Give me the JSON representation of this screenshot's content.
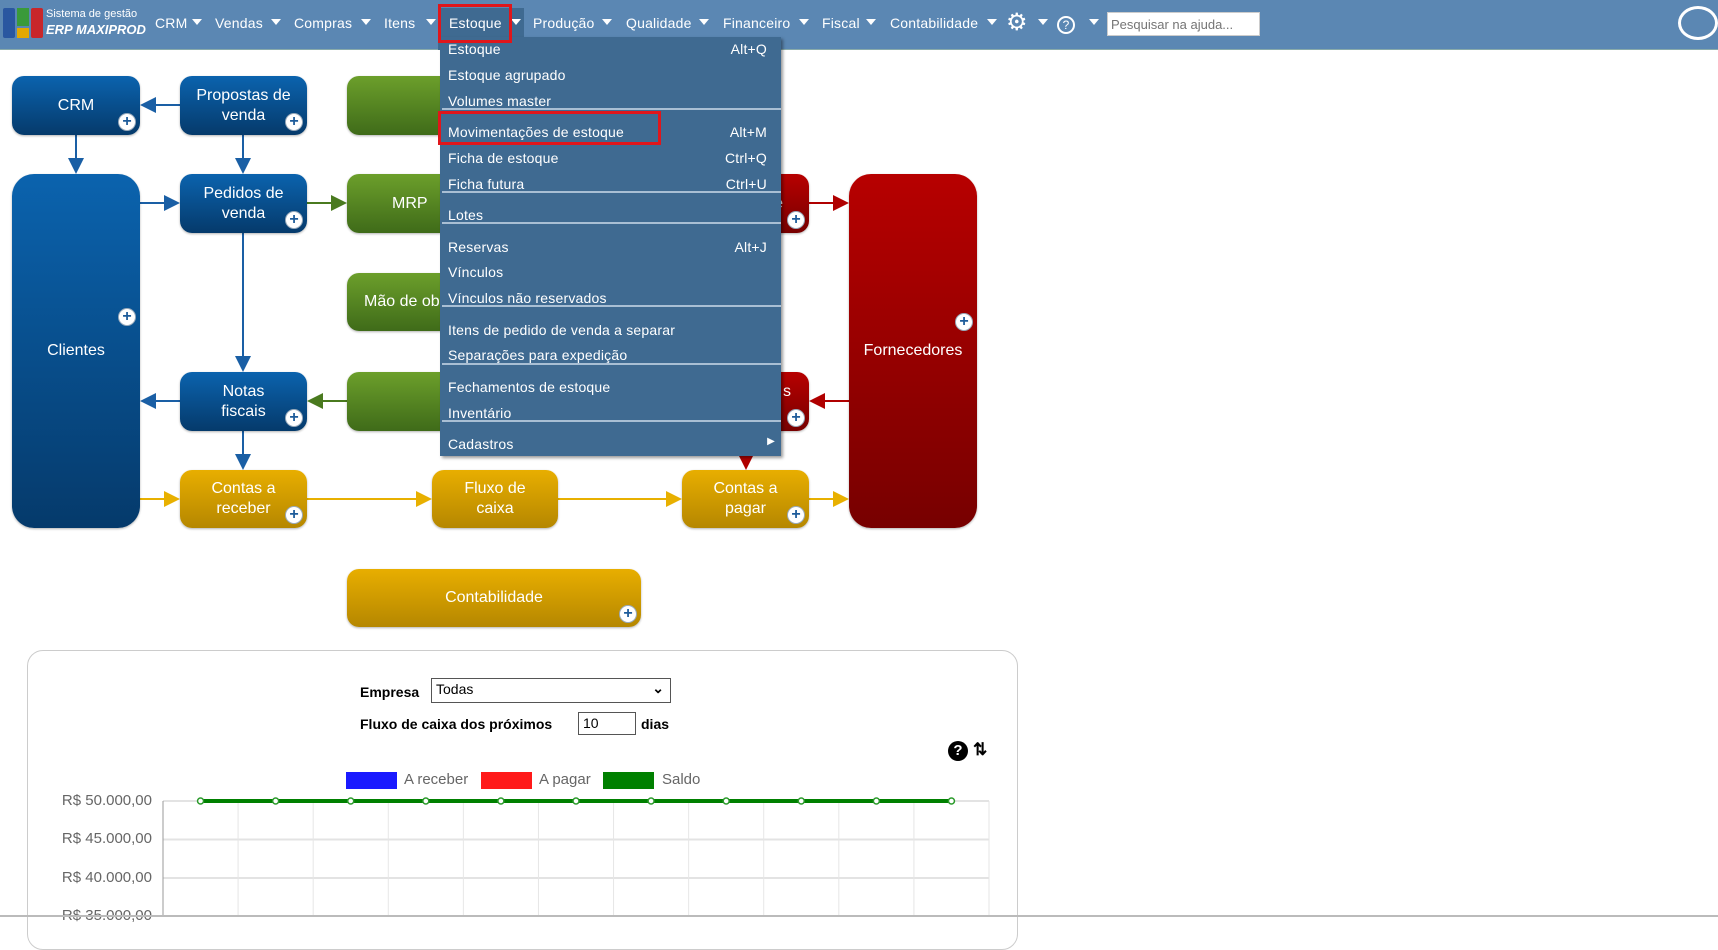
{
  "header": {
    "logo_line1": "Sistema de gestão",
    "logo_line2": "ERP MAXIPROD",
    "nav": [
      "CRM",
      "Vendas",
      "Compras",
      "Itens",
      "Estoque",
      "Produção",
      "Qualidade",
      "Financeiro",
      "Fiscal",
      "Contabilidade"
    ],
    "search_placeholder": "Pesquisar na ajuda..."
  },
  "menu": {
    "items": [
      {
        "label": "Estoque",
        "shortcut": "Alt+Q"
      },
      {
        "label": "Estoque agrupado",
        "shortcut": ""
      },
      {
        "label": "Volumes master",
        "shortcut": ""
      },
      {
        "label": "Movimentações de estoque",
        "shortcut": "Alt+M"
      },
      {
        "label": "Ficha de estoque",
        "shortcut": "Ctrl+Q"
      },
      {
        "label": "Ficha futura",
        "shortcut": "Ctrl+U"
      },
      {
        "label": "Lotes",
        "shortcut": ""
      },
      {
        "label": "Reservas",
        "shortcut": "Alt+J"
      },
      {
        "label": "Vínculos",
        "shortcut": ""
      },
      {
        "label": "Vínculos não reservados",
        "shortcut": ""
      },
      {
        "label": "Itens de pedido de venda a separar",
        "shortcut": ""
      },
      {
        "label": "Separações para expedição",
        "shortcut": ""
      },
      {
        "label": "Fechamentos de estoque",
        "shortcut": ""
      },
      {
        "label": "Inventário",
        "shortcut": ""
      },
      {
        "label": "Cadastros",
        "shortcut": ""
      }
    ]
  },
  "diagram": {
    "crm": "CRM",
    "propostas": "Propostas de\nvenda",
    "clientes": "Clientes",
    "pedidos": "Pedidos de\nvenda",
    "mrp": "MRP",
    "mao": "Mão de ob",
    "notas": "Notas\nfiscais",
    "fornecedores": "Fornecedores",
    "receber": "Contas a\nreceber",
    "fluxo": "Fluxo de\ncaixa",
    "pagar": "Contas a\npagar",
    "contabilidade": "Contabilidade",
    "red1": "e",
    "red2": "s"
  },
  "cashflow": {
    "empresa_label": "Empresa",
    "empresa_value": "Todas",
    "fluxo_label": "Fluxo de caixa dos próximos",
    "dias_value": "10",
    "dias_label": "dias"
  },
  "chart_data": {
    "type": "line",
    "title": "",
    "ylim": [
      35000,
      50000
    ],
    "yticks": [
      "R$ 50.000,00",
      "R$ 45.000,00",
      "R$ 40.000,00",
      "R$ 35.000,00"
    ],
    "legend": [
      "A receber",
      "A pagar",
      "Saldo"
    ],
    "legend_colors": [
      "#1a1aff",
      "#ff1a1a",
      "#008000"
    ],
    "series": [
      {
        "name": "A receber",
        "values": []
      },
      {
        "name": "A pagar",
        "values": []
      },
      {
        "name": "Saldo",
        "values": [
          50000,
          50000,
          50000,
          50000,
          50000,
          50000,
          50000,
          50000,
          50000,
          50000,
          50000
        ]
      }
    ]
  }
}
